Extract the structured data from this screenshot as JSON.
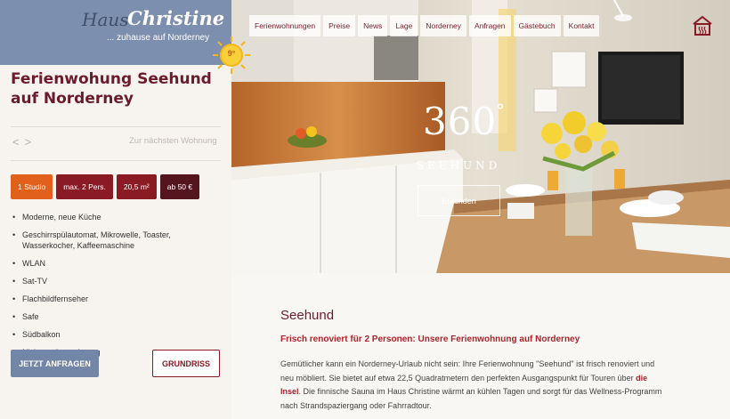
{
  "logo": {
    "part1": "Haus",
    "part2": "Christine",
    "tagline": "... zuhause auf Norderney"
  },
  "weather": {
    "temperature": "9°"
  },
  "apartment": {
    "title": "Ferienwohung Seehund auf Norderney",
    "prev_icon": "<",
    "next_icon": ">",
    "next_label": "Zur nächsten Wohnung",
    "badges": [
      "1 Studio",
      "max. 2 Pers.",
      "20,5 m²",
      "ab 50 €"
    ],
    "features": [
      "Moderne, neue Küche",
      "Geschirrspülautomat, Mikrowelle, Toaster, Wasserkocher, Kaffeemaschine",
      "WLAN",
      "Sat-TV",
      "Flachbildfernseher",
      "Safe",
      "Südbalkon",
      "Nichtraucherwohnung"
    ],
    "request_button": "JETZT ANFRAGEN",
    "floorplan_button": "GRUNDRISS"
  },
  "nav": {
    "items": [
      "Ferienwohnungen",
      "Preise",
      "News",
      "Lage",
      "Norderney",
      "Anfragen",
      "Gästebuch",
      "Kontakt"
    ]
  },
  "hero": {
    "big_text": "360",
    "degree": "°",
    "label": "SEEHUND",
    "button": "Erkunden"
  },
  "content": {
    "title": "Seehund",
    "subtitle": "Frisch renoviert für 2 Personen: Unsere Ferienwohnung auf Norderney",
    "body_part1": "Gemütlicher kann ein Norderney-Urlaub nicht sein: Ihre Ferienwohnung \"Seehund\" ist frisch renoviert und neu möbliert. Sie bietet auf etwa 22,5 Quadratmetern den perfekten Ausgangspunkt für Touren über ",
    "body_link": "die Insel",
    "body_part2": ". Die finnische Sauna im Haus Christine wärmt an kühlen Tagen und sorgt für das Wellness-Programm nach Strandspaziergang oder Fahrradtour."
  },
  "colors": {
    "brand_blue": "#7d8fae",
    "brand_red": "#8a1a24",
    "accent_orange": "#e0601c",
    "link_red": "#b0222a"
  }
}
